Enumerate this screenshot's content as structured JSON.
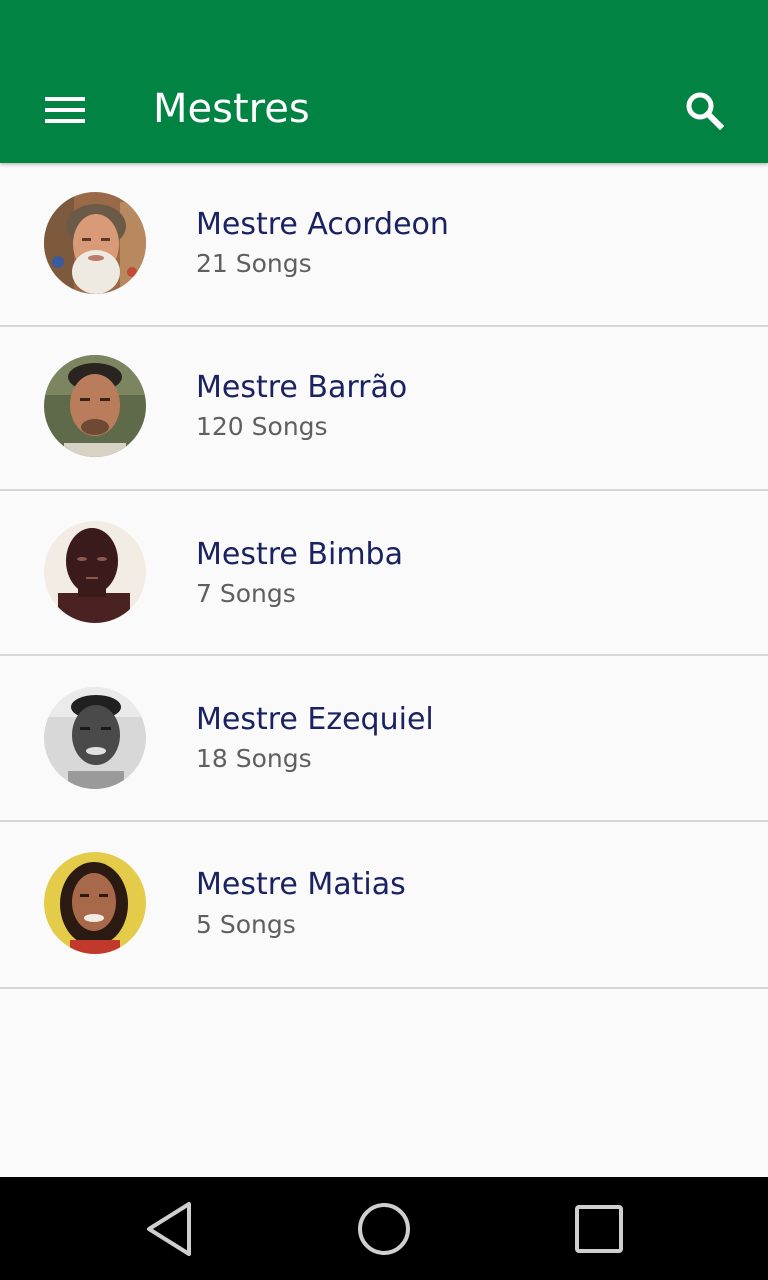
{
  "app_bar": {
    "title": "Mestres",
    "background_color": "#018344",
    "menu_icon": "hamburger-menu-icon",
    "search_icon": "search-icon"
  },
  "mestres": [
    {
      "name": "Mestre Acordeon",
      "count": "21 Songs",
      "avatar_icon": "photo-mestre-acordeon"
    },
    {
      "name": "Mestre Barrão",
      "count": "120 Songs",
      "avatar_icon": "photo-mestre-barrao"
    },
    {
      "name": "Mestre Bimba",
      "count": "7 Songs",
      "avatar_icon": "photo-mestre-bimba"
    },
    {
      "name": "Mestre Ezequiel",
      "count": "18 Songs",
      "avatar_icon": "photo-mestre-ezequiel"
    },
    {
      "name": "Mestre Matias",
      "count": "5 Songs",
      "avatar_icon": "photo-mestre-matias"
    }
  ],
  "colors": {
    "name_text": "#1a2262",
    "count_text": "#5f5f5f",
    "divider": "#d6d6d6"
  },
  "nav_bar": {
    "back_icon": "back-triangle-icon",
    "home_icon": "home-circle-icon",
    "recents_icon": "recents-square-icon"
  }
}
